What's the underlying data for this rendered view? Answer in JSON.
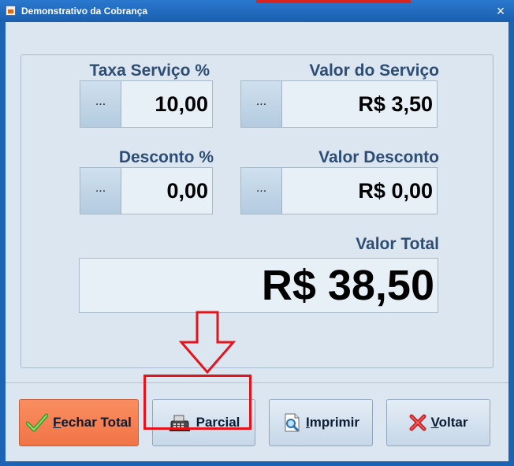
{
  "window": {
    "title": "Demonstrativo da Cobrança",
    "close_glyph": "×",
    "accent_color": "#1c63b5"
  },
  "fields": {
    "taxa_servico": {
      "label": "Taxa Serviço %",
      "button": "...",
      "value": "10,00"
    },
    "valor_servico": {
      "label": "Valor do Serviço",
      "button": "...",
      "value": "R$ 3,50"
    },
    "desconto": {
      "label": "Desconto %",
      "button": "...",
      "value": "0,00"
    },
    "valor_desconto": {
      "label": "Valor Desconto",
      "button": "...",
      "value": "R$ 0,00"
    },
    "valor_total": {
      "label": "Valor Total",
      "value": "R$ 38,50"
    }
  },
  "buttons": {
    "fechar_total": {
      "label_first": "F",
      "label_rest": "echar Total",
      "icon": "checkmark-icon"
    },
    "parcial": {
      "label_first": "P",
      "label_rest": "arcial",
      "icon": "cash-register-icon"
    },
    "imprimir": {
      "label_first": "I",
      "label_rest": "mprimir",
      "icon": "print-preview-icon"
    },
    "voltar": {
      "label_first": "V",
      "label_rest": "oltar",
      "icon": "red-x-icon"
    }
  },
  "annotation": {
    "highlight_color": "#e3141c",
    "target": "parcial"
  }
}
